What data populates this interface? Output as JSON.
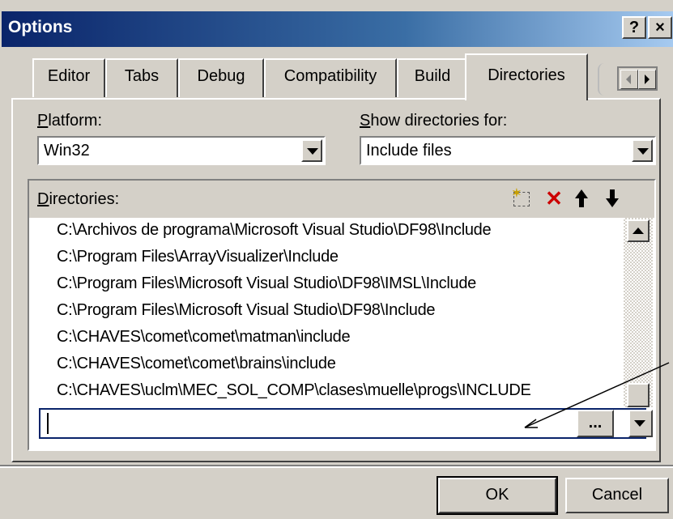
{
  "window": {
    "title": "Options",
    "help_label": "?",
    "close_label": "×"
  },
  "tabs": [
    {
      "label": "Editor"
    },
    {
      "label": "Tabs"
    },
    {
      "label": "Debug"
    },
    {
      "label": "Compatibility"
    },
    {
      "label": "Build"
    },
    {
      "label": "Directories"
    }
  ],
  "active_tab": "Directories",
  "platform": {
    "label_first": "P",
    "label_rest": "latform:",
    "value": "Win32"
  },
  "show_dirs": {
    "label_first": "S",
    "label_rest": "how directories for:",
    "value": "Include files"
  },
  "directories": {
    "label_first": "D",
    "label_rest": "irectories:",
    "toolbar": [
      {
        "name": "new-directory-icon",
        "glyph": "⬚"
      },
      {
        "name": "delete-icon",
        "glyph": "✕"
      },
      {
        "name": "move-up-icon",
        "glyph": "🡑"
      },
      {
        "name": "move-down-icon",
        "glyph": "🡓"
      }
    ],
    "items": [
      "C:\\Archivos de programa\\Microsoft Visual Studio\\DF98\\Include",
      "C:\\Program Files\\ArrayVisualizer\\Include",
      "C:\\Program Files\\Microsoft Visual Studio\\DF98\\IMSL\\Include",
      "C:\\Program Files\\Microsoft Visual Studio\\DF98\\Include",
      "C:\\CHAVES\\comet\\comet\\matman\\include",
      "C:\\CHAVES\\comet\\comet\\brains\\include",
      "C:\\CHAVES\\uclm\\MEC_SOL_COMP\\clases\\muelle\\progs\\INCLUDE"
    ],
    "edit_value": "",
    "browse_label": "..."
  },
  "buttons": {
    "ok": "OK",
    "cancel": "Cancel"
  },
  "colors": {
    "title_start": "#0a246a",
    "title_end": "#a6caf0",
    "face": "#d4d0c8"
  }
}
